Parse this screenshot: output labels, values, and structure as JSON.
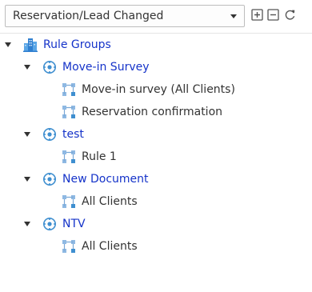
{
  "toolbar": {
    "trigger_select": {
      "value": "Reservation/Lead Changed",
      "icon": "chevron-down-icon"
    },
    "buttons": [
      {
        "name": "expand-all",
        "icon": "plus-square-icon"
      },
      {
        "name": "collapse-all",
        "icon": "minus-square-icon"
      },
      {
        "name": "refresh",
        "icon": "refresh-icon"
      }
    ]
  },
  "tree": {
    "root": {
      "label": "Rule Groups",
      "icon": "building-icon",
      "expanded": true
    },
    "groups": [
      {
        "label": "Move-in Survey",
        "icon": "group-gear-icon",
        "expanded": true,
        "rules": [
          {
            "label": "Move-in survey (All Clients)",
            "icon": "rule-icon"
          },
          {
            "label": "Reservation confirmation",
            "icon": "rule-icon"
          }
        ]
      },
      {
        "label": "test",
        "icon": "group-gear-icon",
        "expanded": true,
        "rules": [
          {
            "label": "Rule 1",
            "icon": "rule-icon"
          }
        ]
      },
      {
        "label": "New Document",
        "icon": "group-gear-icon",
        "expanded": true,
        "rules": [
          {
            "label": "All Clients",
            "icon": "rule-icon"
          }
        ]
      },
      {
        "label": "NTV",
        "icon": "group-gear-icon",
        "expanded": true,
        "rules": [
          {
            "label": "All Clients",
            "icon": "rule-icon"
          }
        ]
      }
    ]
  },
  "colors": {
    "group_label": "#1533c9",
    "rule_label": "#333333",
    "accent_icon": "#3f8fd0"
  }
}
